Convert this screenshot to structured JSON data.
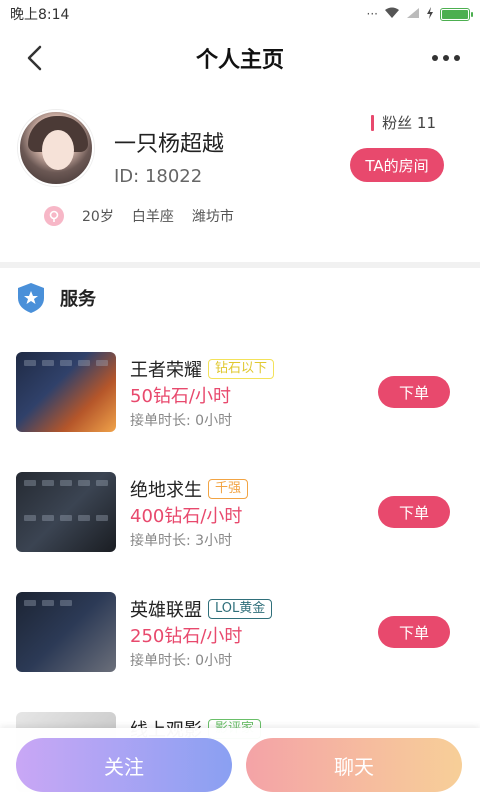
{
  "status_bar": {
    "time": "晚上8:14",
    "signal_icon": "wifi-icon"
  },
  "nav": {
    "title": "个人主页"
  },
  "profile": {
    "nickname": "一只杨超越",
    "id": "ID: 18022",
    "fans_label": "粉丝 11",
    "room_button": "TA的房间",
    "age": "20岁",
    "constellation": "白羊座",
    "city": "潍坊市"
  },
  "services": {
    "title": "服务",
    "order_label": "下单",
    "items": [
      {
        "name": "王者荣耀",
        "tag": "钻石以下",
        "tag_color": "#f3e25a",
        "price": "50钻石/小时",
        "duration": "接单时长: 0小时"
      },
      {
        "name": "绝地求生",
        "tag": "千强",
        "tag_color": "#f2a444",
        "price": "400钻石/小时",
        "duration": "接单时长: 3小时"
      },
      {
        "name": "英雄联盟",
        "tag": "LOL黄金",
        "tag_color": "#2f6f7a",
        "price": "250钻石/小时",
        "duration": "接单时长: 0小时"
      },
      {
        "name": "线上观影",
        "tag": "影评家",
        "tag_color": "#6abf69",
        "price": "",
        "duration": ""
      }
    ]
  },
  "bottom": {
    "follow": "关注",
    "chat": "聊天"
  },
  "colors": {
    "accent": "#e8496d"
  }
}
